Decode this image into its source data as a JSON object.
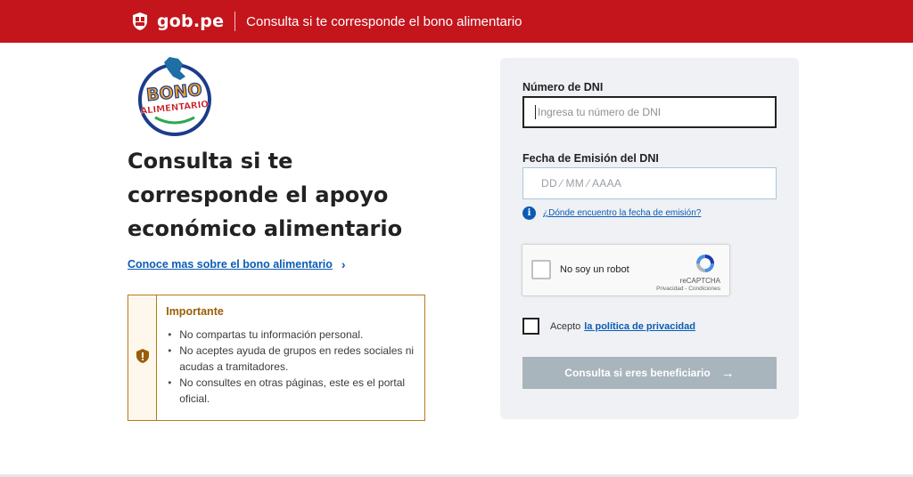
{
  "header": {
    "brand": "gob.pe",
    "title": "Consulta si te corresponde el bono alimentario",
    "background": "#c4151c"
  },
  "logo": {
    "line1": "BONO",
    "line2": "ALIMENTARIO"
  },
  "main": {
    "heading": "Consulta si te corresponde el apoyo económico alimentario",
    "more_link": "Conoce mas sobre el bono alimentario",
    "notice": {
      "title": "Importante",
      "icon": "shield-exclamation-icon",
      "items": [
        "No compartas tu información personal.",
        "No aceptes ayuda de grupos en redes sociales ni acudas a tramitadores.",
        "No consultes en otras páginas, este es el portal oficial."
      ]
    }
  },
  "form": {
    "dni_label": "Número de DNI",
    "dni_placeholder": "Ingresa tu número de DNI",
    "date_label": "Fecha de Emisión del DNI",
    "date_placeholder": "DD ⁄ MM ⁄ AAAA",
    "help_link": "¿Dónde encuentro la fecha de emisión?",
    "recaptcha": {
      "label": "No soy un robot",
      "brand": "reCAPTCHA",
      "terms": "Privacidad - Condiciones"
    },
    "consent_text": "Acepto",
    "consent_link": "la política de privacidad",
    "submit_label": "Consulta si eres beneficiario",
    "accent": "#0b5cb5"
  }
}
